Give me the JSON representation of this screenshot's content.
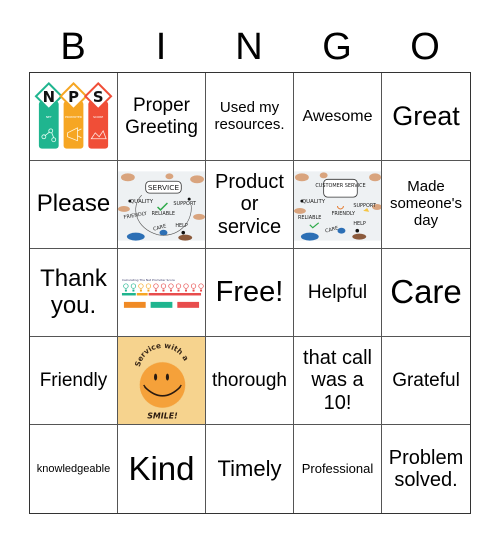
{
  "header": {
    "letters": [
      "B",
      "I",
      "N",
      "G",
      "O"
    ]
  },
  "card": {
    "rows": [
      [
        {
          "type": "image",
          "image": "nps-logo",
          "alt_letters": [
            "N",
            "P",
            "S"
          ],
          "alt_labels": [
            "NET",
            "PROMOTER",
            "SCORE"
          ],
          "colors": [
            "#1fb58f",
            "#f6a623",
            "#f04e37"
          ]
        },
        {
          "type": "text",
          "text": "Proper Greeting"
        },
        {
          "type": "text",
          "text": "Used my resources."
        },
        {
          "type": "text",
          "text": "Awesome"
        },
        {
          "type": "text",
          "text": "Great"
        }
      ],
      [
        {
          "type": "text",
          "text": "Please"
        },
        {
          "type": "image",
          "image": "service-words-photo",
          "words": [
            "SERVICE",
            "QUALITY",
            "SUPPORT",
            "FRIENDLY",
            "RELIABLE",
            "HELP",
            "CARE"
          ]
        },
        {
          "type": "text",
          "text": "Product or service"
        },
        {
          "type": "image",
          "image": "customer-service-words-photo",
          "words": [
            "CUSTOMER SERVICE",
            "QUALITY",
            "SUPPORT",
            "RELIABLE",
            "FRIENDLY",
            "HELP",
            "CARE"
          ]
        },
        {
          "type": "text",
          "text": "Made someone's day"
        }
      ],
      [
        {
          "type": "text",
          "text": "Thank you."
        },
        {
          "type": "image",
          "image": "nps-calculation-chart",
          "title": "Calculating The Net Promoter Score",
          "segment_colors": [
            "#1fb58f",
            "#f6a623",
            "#e84c4c"
          ]
        },
        {
          "type": "text",
          "text": "Free!"
        },
        {
          "type": "text",
          "text": "Helpful"
        },
        {
          "type": "text",
          "text": "Care"
        }
      ],
      [
        {
          "type": "text",
          "text": "Friendly"
        },
        {
          "type": "free",
          "image": "smiley-face",
          "top_text": "Service with a",
          "bottom_text": "SMILE!",
          "background": "#f6d38e",
          "face_color": "#f5a13a"
        },
        {
          "type": "text",
          "text": "thorough"
        },
        {
          "type": "text",
          "text": "that call was a 10!"
        },
        {
          "type": "text",
          "text": "Grateful"
        }
      ],
      [
        {
          "type": "text",
          "text": "knowledgeable"
        },
        {
          "type": "text",
          "text": "Kind"
        },
        {
          "type": "text",
          "text": "Timely"
        },
        {
          "type": "text",
          "text": "Professional"
        },
        {
          "type": "text",
          "text": "Problem solved."
        }
      ]
    ]
  }
}
